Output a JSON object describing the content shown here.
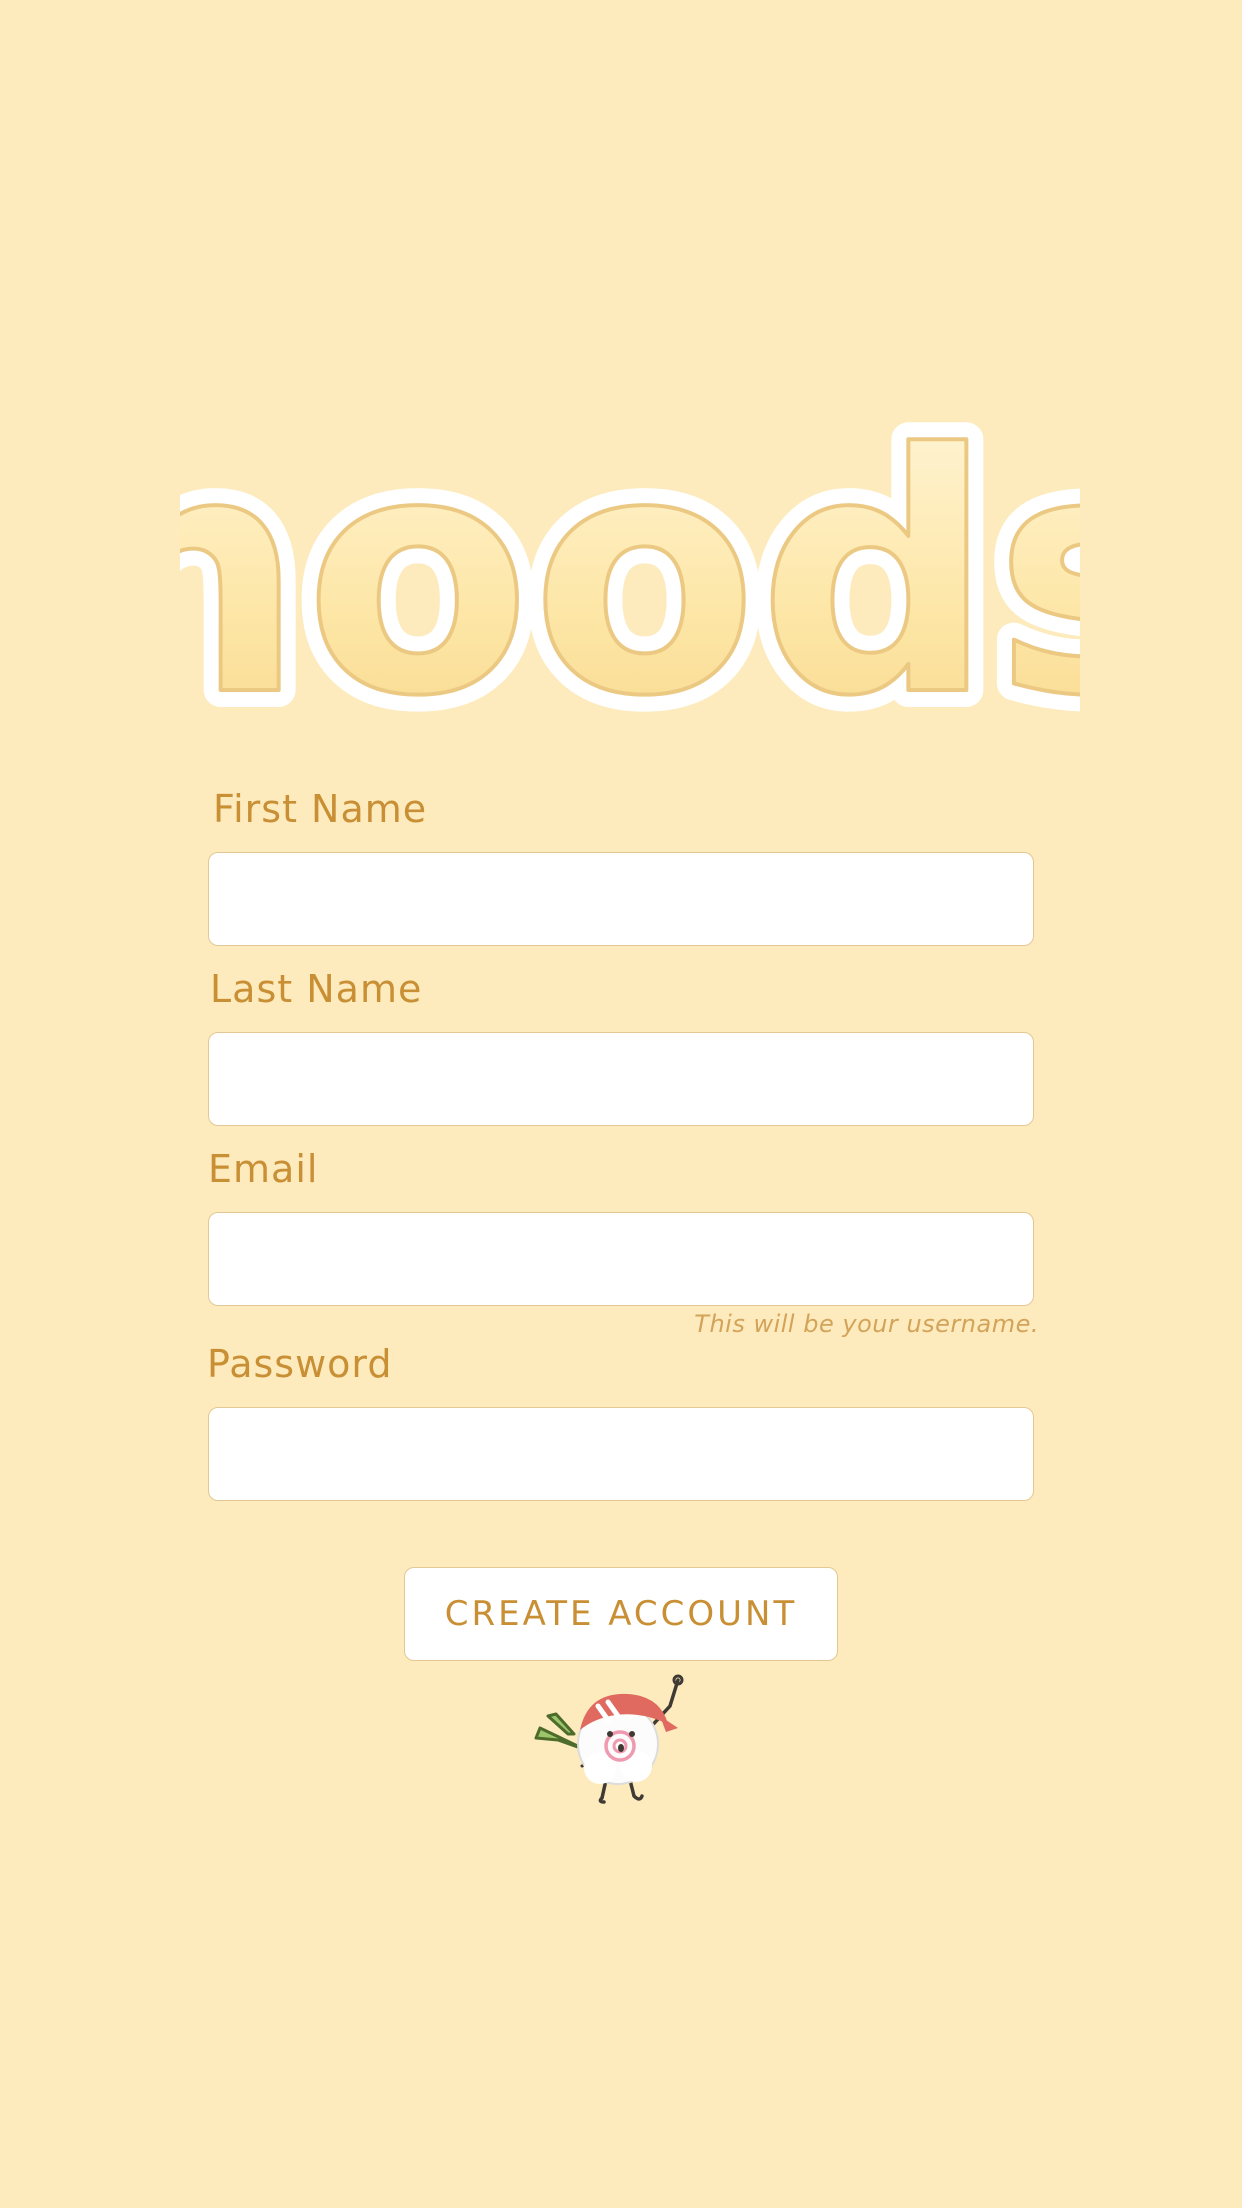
{
  "brand": {
    "logo_text": "noods"
  },
  "form": {
    "first_name": {
      "label": "First Name",
      "value": "",
      "placeholder": ""
    },
    "last_name": {
      "label": "Last Name",
      "value": "",
      "placeholder": ""
    },
    "email": {
      "label": "Email",
      "value": "",
      "placeholder": "",
      "helper": "This will be your username."
    },
    "password": {
      "label": "Password",
      "value": "",
      "placeholder": ""
    },
    "submit_label": "CREATE ACCOUNT"
  },
  "mascot": {
    "icon": "noodle-mascot-icon"
  },
  "colors": {
    "background": "#fdebbd",
    "accent": "#c98f35",
    "input_border": "#e4c894",
    "logo_fill": "#fde9b3"
  }
}
